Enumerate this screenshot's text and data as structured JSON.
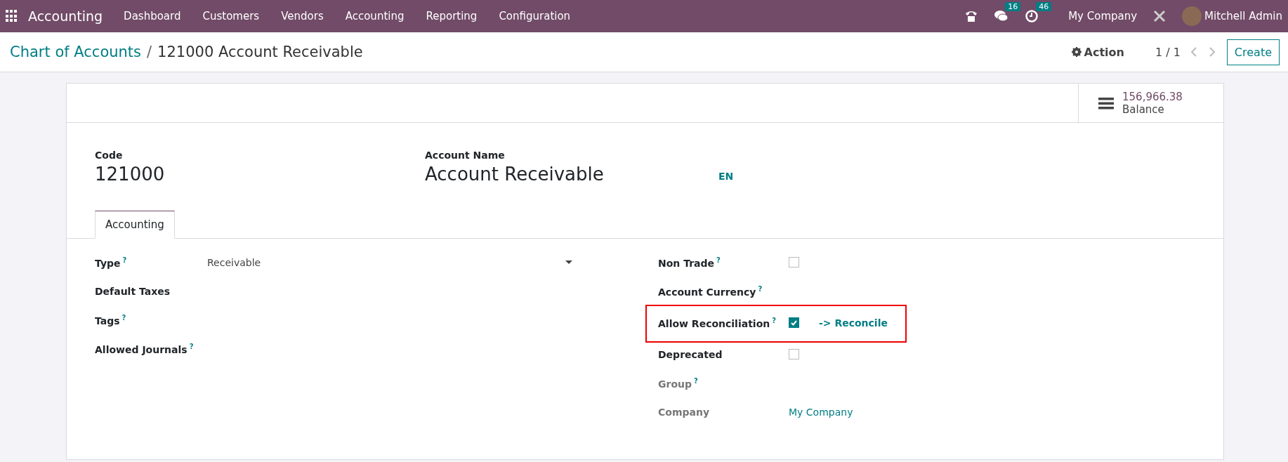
{
  "navbar": {
    "app": "Accounting",
    "menu": [
      "Dashboard",
      "Customers",
      "Vendors",
      "Accounting",
      "Reporting",
      "Configuration"
    ],
    "messages_count": "16",
    "activities_count": "46",
    "company": "My Company",
    "user": "Mitchell Admin"
  },
  "control_panel": {
    "breadcrumb": "Chart of Accounts",
    "separator": "/",
    "title": "121000 Account Receivable",
    "action": "Action",
    "pager": "1 / 1",
    "create": "Create"
  },
  "stat_button": {
    "value": "156,966.38",
    "label": "Balance"
  },
  "header": {
    "code_label": "Code",
    "code": "121000",
    "name_label": "Account Name",
    "name": "Account Receivable",
    "lang": "EN"
  },
  "tabs": [
    {
      "label": "Accounting",
      "selected": true
    }
  ],
  "left_fields": [
    {
      "label": "Type",
      "help": "?",
      "kind": "select",
      "value": "Receivable"
    },
    {
      "label": "Default Taxes",
      "kind": "empty"
    },
    {
      "label": "Tags",
      "help": "?",
      "kind": "empty"
    },
    {
      "label": "Allowed Journals",
      "help": "?",
      "kind": "empty"
    }
  ],
  "right_fields": [
    {
      "label": "Non Trade",
      "help": "?",
      "kind": "checkbox",
      "checked": false,
      "muted": false,
      "highlighted": false
    },
    {
      "label": "Account Currency",
      "help": "?",
      "kind": "empty",
      "muted": false,
      "highlighted": false
    },
    {
      "label": "Allow Reconciliation",
      "help": "?",
      "kind": "checkbox",
      "checked": true,
      "link": "-> Reconcile",
      "muted": false,
      "highlighted": true
    },
    {
      "label": "Deprecated",
      "kind": "checkbox",
      "checked": false,
      "muted": false,
      "highlighted": false
    },
    {
      "label": "Group",
      "help": "?",
      "kind": "empty",
      "muted": true,
      "highlighted": false
    },
    {
      "label": "Company",
      "kind": "link",
      "value": "My Company",
      "muted": true,
      "highlighted": false
    }
  ]
}
